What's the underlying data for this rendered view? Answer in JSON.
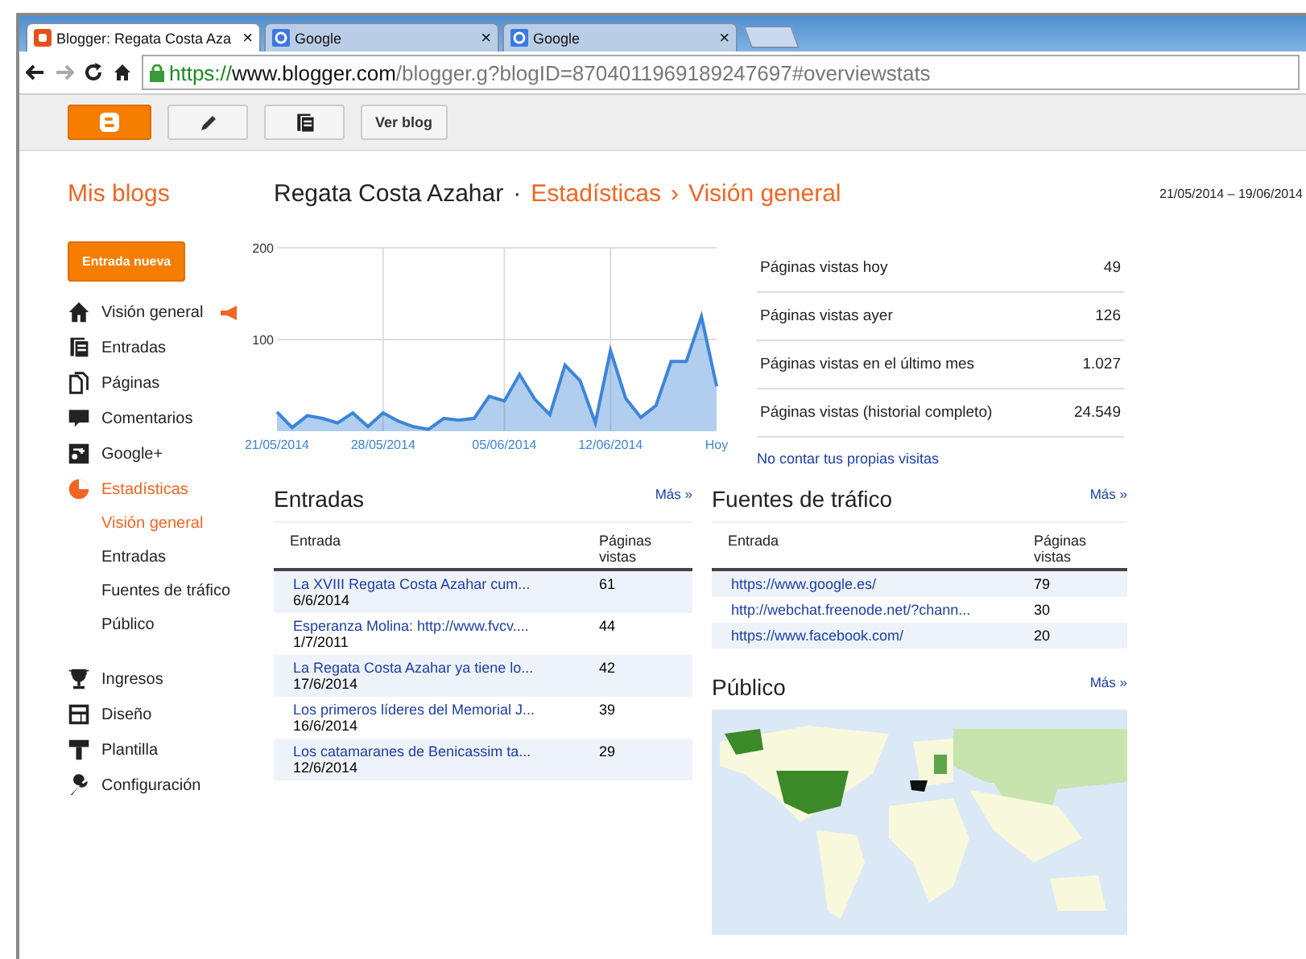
{
  "browser": {
    "tabs": [
      {
        "kind": "blogger",
        "title": "Blogger: Regata Costa Aza",
        "close": "×",
        "selected": true
      },
      {
        "kind": "google",
        "title": "Google",
        "close": "×",
        "selected": false
      },
      {
        "kind": "google",
        "title": "Google",
        "close": "×",
        "selected": false
      }
    ],
    "address": {
      "scheme": "https://",
      "host": "www.blogger.com",
      "path": "/blogger.g?blogID=8704011969189247697#overviewstats"
    }
  },
  "toolbar": {
    "view_blog": "Ver blog"
  },
  "header": {
    "my_blogs": "Mis blogs",
    "blog": "Regata Costa Azahar",
    "separator": "·",
    "section": "Estadísticas",
    "arrow": "›",
    "page": "Visión general",
    "date_range": "21/05/2014 – 19/06/2014"
  },
  "sidebar": {
    "new_post": "Entrada nueva",
    "items": [
      {
        "label": "Visión general",
        "selected": false
      },
      {
        "label": "Entradas",
        "selected": false
      },
      {
        "label": "Páginas",
        "selected": false
      },
      {
        "label": "Comentarios",
        "selected": false
      },
      {
        "label": "Google+",
        "selected": false
      },
      {
        "label": "Estadísticas",
        "selected": true,
        "children": [
          {
            "label": "Visión general",
            "selected": true
          },
          {
            "label": "Entradas",
            "selected": false
          },
          {
            "label": "Fuentes de tráfico",
            "selected": false
          },
          {
            "label": "Público",
            "selected": false
          }
        ]
      },
      {
        "label": "Ingresos",
        "selected": false
      },
      {
        "label": "Diseño",
        "selected": false
      },
      {
        "label": "Plantilla",
        "selected": false
      },
      {
        "label": "Configuración",
        "selected": false
      }
    ]
  },
  "chart_data": {
    "type": "area",
    "grid": true,
    "ylim": [
      0,
      200
    ],
    "yticks": [
      100,
      200
    ],
    "categories": [
      "21/05/2014",
      null,
      null,
      null,
      null,
      null,
      null,
      "28/05/2014",
      null,
      null,
      null,
      null,
      null,
      null,
      null,
      "05/06/2014",
      null,
      null,
      null,
      null,
      null,
      null,
      "12/06/2014",
      null,
      null,
      null,
      null,
      null,
      null,
      "Hoy"
    ],
    "series": [
      {
        "color": "#3d85d8",
        "values": [
          21,
          4,
          17,
          14,
          9,
          20,
          5,
          20,
          11,
          5,
          2,
          14,
          12,
          14,
          38,
          33,
          62,
          35,
          18,
          72,
          55,
          9,
          88,
          36,
          15,
          28,
          76,
          76,
          125,
          49
        ]
      }
    ]
  },
  "stats": {
    "rows": [
      {
        "label": "Páginas vistas hoy",
        "value": "49"
      },
      {
        "label": "Páginas vistas ayer",
        "value": "126"
      },
      {
        "label": "Páginas vistas en el último mes",
        "value": "1.027"
      },
      {
        "label": "Páginas vistas (historial completo)",
        "value": "24.549"
      }
    ],
    "link": "No contar tus propias visitas"
  },
  "posts": {
    "title": "Entradas",
    "more": "Más »",
    "columns": [
      "Entrada",
      "Páginas vistas"
    ],
    "rows": [
      {
        "title": "La XVIII Regata Costa Azahar cum...",
        "date": "6/6/2014",
        "views": "61"
      },
      {
        "title": "Esperanza Molina: http://www.fvcv....",
        "date": "1/7/2011",
        "views": "44"
      },
      {
        "title": "La Regata Costa Azahar ya tiene lo...",
        "date": "17/6/2014",
        "views": "42"
      },
      {
        "title": "Los primeros líderes del Memorial J...",
        "date": "16/6/2014",
        "views": "39"
      },
      {
        "title": "Los catamaranes de Benicassim ta...",
        "date": "12/6/2014",
        "views": "29"
      }
    ]
  },
  "traffic": {
    "title": "Fuentes de tráfico",
    "more": "Más »",
    "columns": [
      "Entrada",
      "Páginas vistas"
    ],
    "rows": [
      {
        "url": "https://www.google.es/",
        "views": "79"
      },
      {
        "url": "http://webchat.freenode.net/?chann...",
        "views": "30"
      },
      {
        "url": "https://www.facebook.com/",
        "views": "20"
      }
    ]
  },
  "audience": {
    "title": "Público",
    "more": "Más »"
  }
}
